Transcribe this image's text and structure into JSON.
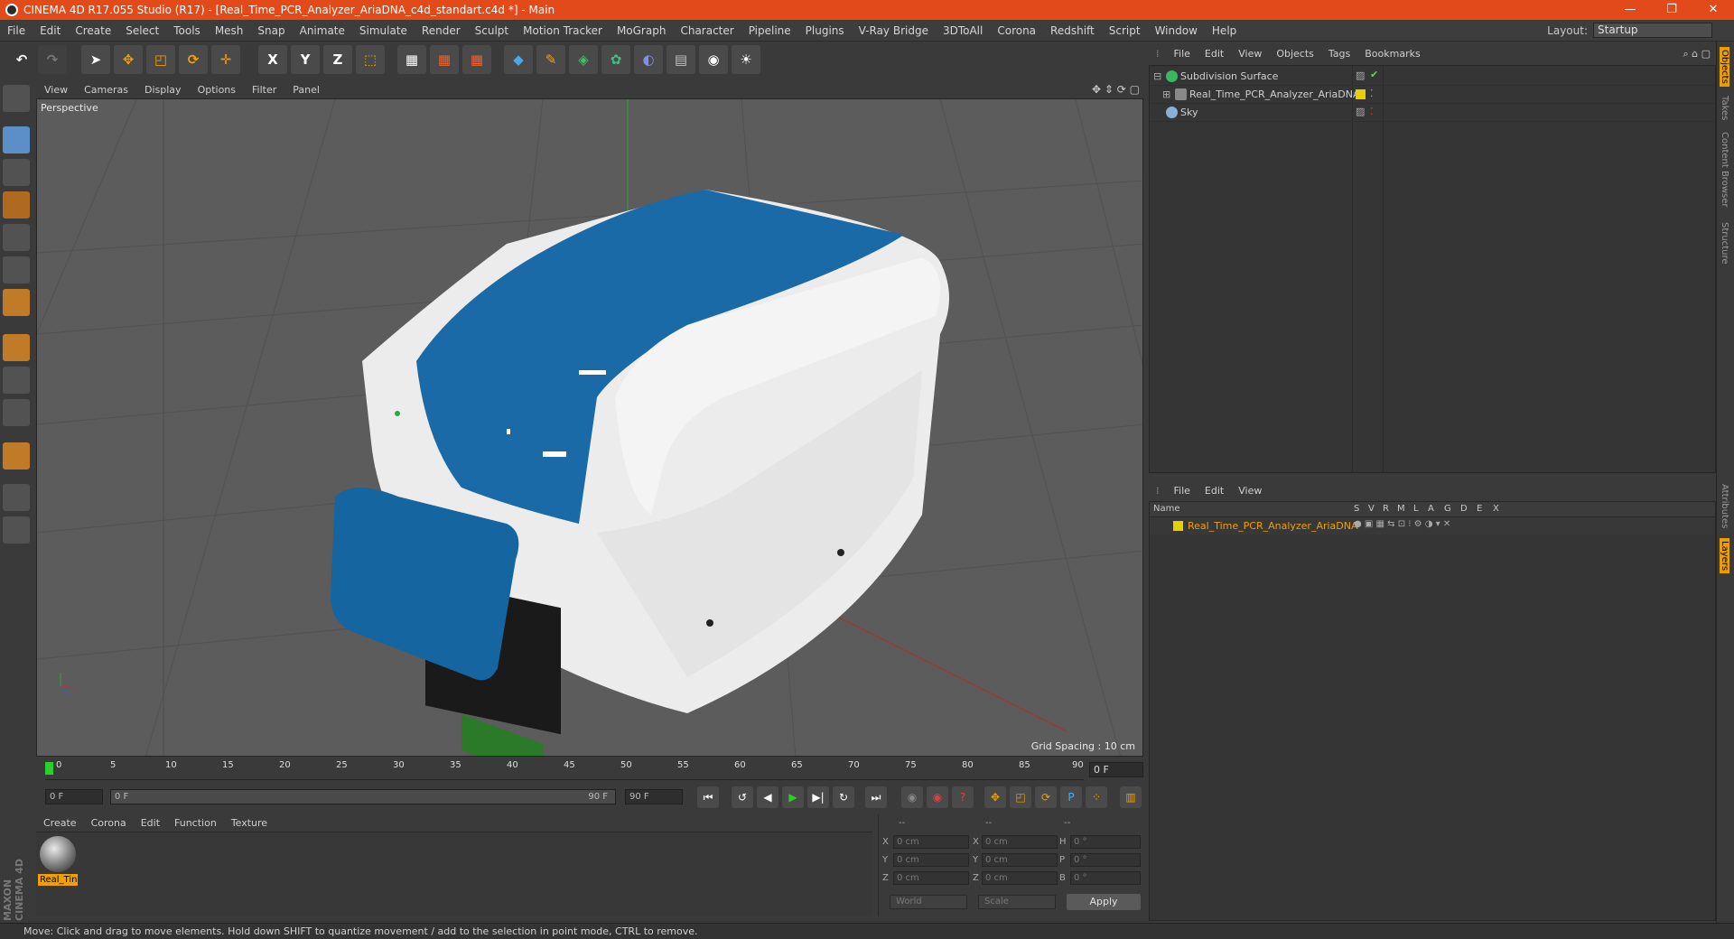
{
  "window": {
    "title": "CINEMA 4D R17.055 Studio (R17) - [Real_Time_PCR_Analyzer_AriaDNA_c4d_standart.c4d *] - Main",
    "minimize": "—",
    "maximize": "❐",
    "close": "✕"
  },
  "menubar": {
    "items": [
      "File",
      "Edit",
      "Create",
      "Select",
      "Tools",
      "Mesh",
      "Snap",
      "Animate",
      "Simulate",
      "Render",
      "Sculpt",
      "Motion Tracker",
      "MoGraph",
      "Character",
      "Pipeline",
      "Plugins",
      "V-Ray Bridge",
      "3DToAll",
      "Corona",
      "Redshift",
      "Script",
      "Window",
      "Help"
    ],
    "layout_label": "Layout:",
    "layout_value": "Startup"
  },
  "toolbar": {
    "x_label": "X",
    "y_label": "Y",
    "z_label": "Z"
  },
  "viewport": {
    "menu": [
      "View",
      "Cameras",
      "Display",
      "Options",
      "Filter",
      "Panel"
    ],
    "label": "Perspective",
    "grid_spacing": "Grid Spacing : 10 cm"
  },
  "timeline": {
    "ticks": [
      "0",
      "5",
      "10",
      "15",
      "20",
      "25",
      "30",
      "35",
      "40",
      "45",
      "50",
      "55",
      "60",
      "65",
      "70",
      "75",
      "80",
      "85",
      "90"
    ],
    "current_frame": "0 F"
  },
  "transport": {
    "start": "0 F",
    "range_start": "0 F",
    "range_end": "90 F",
    "end": "90 F"
  },
  "material_manager": {
    "menu": [
      "Create",
      "Corona",
      "Edit",
      "Function",
      "Texture"
    ],
    "material_label": "Real_Tin"
  },
  "coordinates": {
    "header": [
      "--",
      "--",
      "--"
    ],
    "rows": [
      {
        "a": "X",
        "av": "0 cm",
        "b": "X",
        "bv": "0 cm",
        "c": "H",
        "cv": "0 °"
      },
      {
        "a": "Y",
        "av": "0 cm",
        "b": "Y",
        "bv": "0 cm",
        "c": "P",
        "cv": "0 °"
      },
      {
        "a": "Z",
        "av": "0 cm",
        "b": "Z",
        "bv": "0 cm",
        "c": "B",
        "cv": "0 °"
      }
    ],
    "world": "World",
    "scale": "Scale",
    "apply": "Apply"
  },
  "object_manager": {
    "menu": [
      "File",
      "Edit",
      "View",
      "Objects",
      "Tags",
      "Bookmarks"
    ],
    "objects": [
      {
        "name": "Subdivision Surface"
      },
      {
        "name": "Real_Time_PCR_Analyzer_AriaDNA"
      },
      {
        "name": "Sky"
      }
    ]
  },
  "layer_manager": {
    "menu": [
      "File",
      "Edit",
      "View"
    ],
    "columns": [
      "Name",
      "S",
      "V",
      "R",
      "M",
      "L",
      "A",
      "G",
      "D",
      "E",
      "X"
    ],
    "layer_name": "Real_Time_PCR_Analyzer_AriaDNA"
  },
  "side_tabs": [
    "Objects",
    "Takes",
    "Content Browser",
    "Structure",
    "Attributes",
    "Layers"
  ],
  "branding": "MAXON CINEMA 4D",
  "status": "Move: Click and drag to move elements. Hold down SHIFT to quantize movement / add to the selection in point mode, CTRL to remove.",
  "colors": {
    "titlebar": "#e24a1a",
    "device_blue": "#1a6aa8",
    "device_white": "#ededed",
    "layer_yellow": "#e8d000",
    "layer_text": "#f0a000"
  }
}
